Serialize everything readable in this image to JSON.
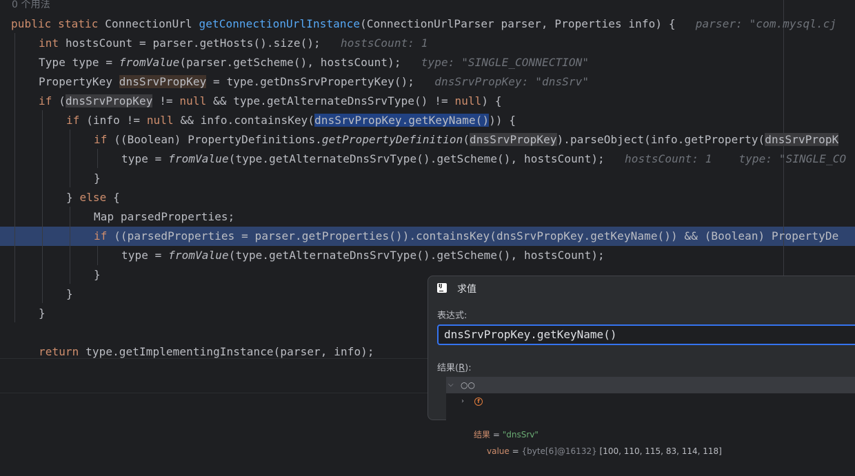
{
  "editor": {
    "usages": "0 个用法",
    "lines": [
      [
        [
          "kw",
          "public static "
        ],
        [
          "p",
          "ConnectionUrl "
        ],
        [
          "fn",
          "getConnectionUrlInstance"
        ],
        [
          "p",
          "(ConnectionUrlParser parser, Properties info) {  "
        ],
        [
          "hint",
          " parser: \"com.mysql.cj"
        ]
      ],
      [
        [
          "kw",
          "int "
        ],
        [
          "p",
          "hostsCount = parser.getHosts().size();  "
        ],
        [
          "hint",
          " hostsCount: 1"
        ]
      ],
      [
        [
          "p",
          "Type type = "
        ],
        [
          "it",
          "fromValue"
        ],
        [
          "p",
          "(parser.getScheme(), hostsCount);  "
        ],
        [
          "hint",
          " type: \"SINGLE_CONNECTION\""
        ]
      ],
      [
        [
          "p",
          "PropertyKey "
        ],
        [
          "occw",
          "dnsSrvPropKey"
        ],
        [
          "p",
          " = type.getDnsSrvPropertyKey();  "
        ],
        [
          "hint",
          " dnsSrvPropKey: \"dnsSrv\""
        ]
      ],
      [
        [
          "kw",
          "if "
        ],
        [
          "p",
          "("
        ],
        [
          "occ",
          "dnsSrvPropKey"
        ],
        [
          "p",
          " != "
        ],
        [
          "kw",
          "null "
        ],
        [
          "p",
          "&& type.getAlternateDnsSrvType() != "
        ],
        [
          "kw",
          "null"
        ],
        [
          "p",
          ") {"
        ]
      ],
      [
        [
          "kw",
          "if "
        ],
        [
          "p",
          "(info != "
        ],
        [
          "kw",
          "null "
        ],
        [
          "p",
          "&& info.containsKey("
        ],
        [
          "sel",
          "dnsSrvPropKey.getKeyName()"
        ],
        [
          "p",
          ")) {"
        ]
      ],
      [
        [
          "kw",
          "if "
        ],
        [
          "p",
          "((Boolean) PropertyDefinitions."
        ],
        [
          "it",
          "getPropertyDefinition"
        ],
        [
          "p",
          "("
        ],
        [
          "occ",
          "dnsSrvPropKey"
        ],
        [
          "p",
          ").parseObject(info.getProperty("
        ],
        [
          "occ",
          "dnsSrvPropK"
        ]
      ],
      [
        [
          "p",
          "type = "
        ],
        [
          "it",
          "fromValue"
        ],
        [
          "p",
          "(type.getAlternateDnsSrvType().getScheme(), hostsCount);  "
        ],
        [
          "hint",
          " hostsCount: 1    type: \"SINGLE_CO"
        ]
      ],
      [
        [
          "p",
          "}"
        ]
      ],
      [
        [
          "p",
          "} "
        ],
        [
          "kw",
          "else "
        ],
        [
          "p",
          "{"
        ]
      ],
      [
        [
          "p",
          "Map parsedProperties;"
        ]
      ],
      [
        [
          "kw",
          "if "
        ],
        [
          "p",
          "((parsedProperties = parser.getProperties()).containsKey(dnsSrvPropKey.getKeyName()) && (Boolean) PropertyDe"
        ]
      ],
      [
        [
          "p",
          "type = "
        ],
        [
          "it",
          "fromValue"
        ],
        [
          "p",
          "(type.getAlternateDnsSrvType().getScheme(), hostsCount);"
        ]
      ],
      [
        [
          "p",
          "}"
        ]
      ],
      [
        [
          "p",
          "}"
        ]
      ],
      [
        [
          "p",
          "}"
        ]
      ],
      [
        [
          "p",
          ""
        ]
      ],
      [
        [
          "kw",
          "return "
        ],
        [
          "p",
          "type.getImplementingInstance(parser, info);"
        ]
      ]
    ]
  },
  "dialog": {
    "title": "求值",
    "app_icon_text": "IJ",
    "expression_label": "表达式:",
    "expression_value": "dnsSrvPropKey.getKeyName()",
    "result_label": "结果(R):",
    "result_label_prefix": "结果(",
    "result_label_mnemonic": "R",
    "result_label_suffix": "):",
    "result_row": {
      "name": "结果",
      "eq": " = ",
      "value": "\"dnsSrv\""
    },
    "value_row": {
      "name": "value",
      "eq": " = ",
      "type": "{byte[6]@16132} ",
      "value": "[100, 110, 115, 83, 114, 118]"
    }
  },
  "colors": {
    "keyword": "#cf8e6d",
    "method": "#56a8f5",
    "string": "#6aab73",
    "hint": "#6f737a",
    "selection": "#214283",
    "focus": "#3574f0"
  },
  "icons": [
    "intellij-app-icon",
    "expand-chevron-icon",
    "watch-glasses-icon",
    "field-icon"
  ]
}
